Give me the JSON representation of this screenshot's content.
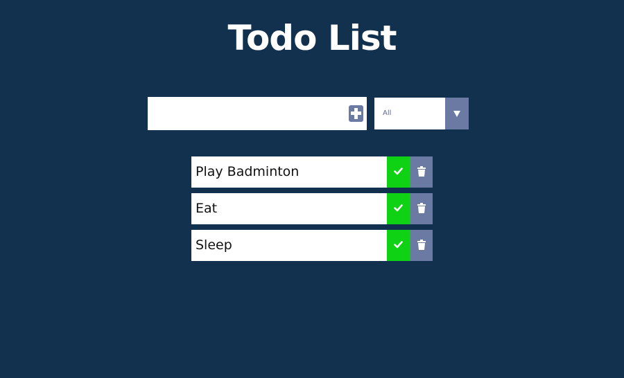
{
  "header": {
    "title": "Todo List"
  },
  "form": {
    "input_value": "",
    "input_placeholder": "",
    "add_icon": "plus-square-icon",
    "filter": {
      "selected": "All",
      "arrow_icon": "caret-down-icon"
    }
  },
  "todos": [
    {
      "text": "Play Badminton"
    },
    {
      "text": "Eat"
    },
    {
      "text": "Sleep"
    }
  ],
  "icons": {
    "complete": "check-icon",
    "delete": "trash-icon"
  },
  "colors": {
    "background": "#12314f",
    "accent": "#6b7aa3",
    "complete": "#10d215",
    "surface": "#ffffff"
  }
}
